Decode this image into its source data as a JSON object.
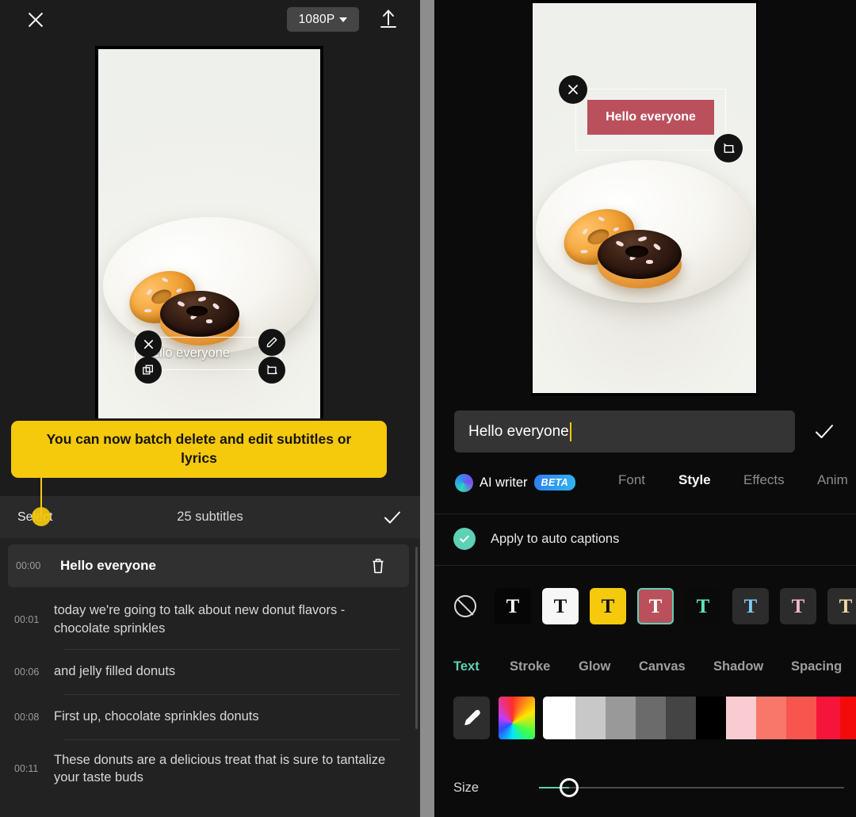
{
  "left": {
    "topbar": {
      "close_icon": "close-icon",
      "resolution": "1080P",
      "export_icon": "export-icon"
    },
    "preview": {
      "overlay_text": "Hello everyone",
      "controls": [
        "close-icon",
        "copy-icon",
        "edit-icon",
        "rotate-icon"
      ]
    },
    "tooltip": {
      "message": "You can now batch delete and edit subtitles or lyrics"
    },
    "subtitle_header": {
      "select_label": "Select",
      "count_label": "25 subtitles",
      "confirm_icon": "check-icon"
    },
    "subtitles": [
      {
        "time": "00:00",
        "text": "Hello everyone",
        "active": true,
        "delete_icon": "trash-icon"
      },
      {
        "time": "00:01",
        "text": "today we're going to talk about new donut flavors - chocolate sprinkles",
        "active": false
      },
      {
        "time": "00:06",
        "text": "and jelly filled donuts",
        "active": false
      },
      {
        "time": "00:08",
        "text": "First up, chocolate sprinkles donuts",
        "active": false
      },
      {
        "time": "00:11",
        "text": "These donuts are a delicious treat that is sure to tantalize your taste buds",
        "active": false
      }
    ]
  },
  "right": {
    "preview": {
      "overlay_text": "Hello everyone",
      "box_color": "#b9505c",
      "controls": [
        "close-icon",
        "rotate-icon"
      ]
    },
    "text_input": {
      "value": "Hello everyone",
      "confirm_icon": "check-icon",
      "caret_color": "#f5c90c"
    },
    "tabs": {
      "ai_writer_label": "AI writer",
      "beta_badge": "BETA",
      "items": [
        {
          "label": "Font",
          "active": false
        },
        {
          "label": "Style",
          "active": true
        },
        {
          "label": "Effects",
          "active": false
        },
        {
          "label": "Anim",
          "active": false
        }
      ]
    },
    "apply_captions": {
      "label": "Apply to auto captions",
      "checked": true,
      "check_color": "#5ed0b4"
    },
    "style_presets": [
      {
        "name": "none",
        "bg": "none",
        "fg": "#d9d9d9",
        "selected": false
      },
      {
        "name": "black-box-white-text",
        "bg": "#060606",
        "fg": "#ffffff",
        "selected": false
      },
      {
        "name": "white-box-black-text",
        "bg": "#f7f7f7",
        "fg": "#111111",
        "selected": false
      },
      {
        "name": "yellow-box-black-text",
        "bg": "#f5c90c",
        "fg": "#111111",
        "selected": false
      },
      {
        "name": "red-box-white-text",
        "bg": "#b9505c",
        "fg": "#ffffff",
        "selected": true
      },
      {
        "name": "black-box-mint-text",
        "bg": "#0a0a0a",
        "fg": "#5fe7b5",
        "selected": false
      },
      {
        "name": "dark-box-blue-text",
        "bg": "#2c2c2c",
        "fg": "#7ec8f5",
        "selected": false
      },
      {
        "name": "dark-box-pink-text",
        "bg": "#2c2c2c",
        "fg": "#f0b9c4",
        "selected": false
      },
      {
        "name": "dark-box-cream-text",
        "bg": "#2c2c2c",
        "fg": "#efd7a8",
        "selected": false
      }
    ],
    "sub_tabs": [
      {
        "label": "Text",
        "active": true
      },
      {
        "label": "Stroke",
        "active": false
      },
      {
        "label": "Glow",
        "active": false
      },
      {
        "label": "Canvas",
        "active": false
      },
      {
        "label": "Shadow",
        "active": false
      },
      {
        "label": "Spacing",
        "active": false
      }
    ],
    "color_tools": {
      "eyedropper_icon": "eyedropper-icon",
      "rainbow_icon": "color-wheel-icon"
    },
    "color_swatches": [
      "#ffffff",
      "#c8c8c8",
      "#999999",
      "#6b6b6b",
      "#444444",
      "#000000",
      "#f8ccd0",
      "#f9776a",
      "#f8554f",
      "#f5153a",
      "#f30b0b"
    ],
    "size_slider": {
      "label": "Size",
      "value_percent": 7,
      "fill_color": "#5ed0b4"
    }
  }
}
